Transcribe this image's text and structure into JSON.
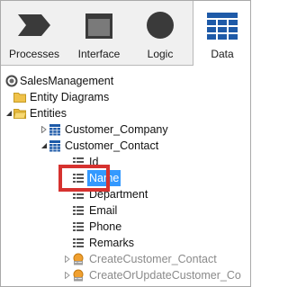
{
  "toolbar": {
    "tabs": [
      {
        "label": "Processes",
        "icon": "processes-icon"
      },
      {
        "label": "Interface",
        "icon": "interface-icon"
      },
      {
        "label": "Logic",
        "icon": "logic-icon"
      },
      {
        "label": "Data",
        "icon": "data-icon",
        "selected": true
      }
    ]
  },
  "tree": {
    "root": {
      "label": "SalesManagement",
      "icon": "module-icon"
    },
    "entity_diagrams": {
      "label": "Entity Diagrams",
      "icon": "folder-icon"
    },
    "entities": {
      "label": "Entities",
      "icon": "folder-open-icon"
    },
    "customer_company": {
      "label": "Customer_Company",
      "icon": "entity-icon"
    },
    "customer_contact": {
      "label": "Customer_Contact",
      "icon": "entity-icon"
    },
    "attributes": [
      {
        "label": "Id",
        "icon": "attribute-icon"
      },
      {
        "label": "Name",
        "icon": "attribute-icon",
        "selected": true
      },
      {
        "label": "Department",
        "icon": "attribute-icon"
      },
      {
        "label": "Email",
        "icon": "attribute-icon"
      },
      {
        "label": "Phone",
        "icon": "attribute-icon"
      },
      {
        "label": "Remarks",
        "icon": "attribute-icon"
      }
    ],
    "actions": [
      {
        "label": "CreateCustomer_Contact",
        "icon": "entity-action-icon"
      },
      {
        "label": "CreateOrUpdateCustomer_Co",
        "icon": "entity-action-icon"
      }
    ]
  },
  "colors": {
    "selection": "#3399ff",
    "highlight_border": "#d6322f",
    "data_icon_blue": "#1e5aa8",
    "folder_yellow": "#f0c24a"
  }
}
